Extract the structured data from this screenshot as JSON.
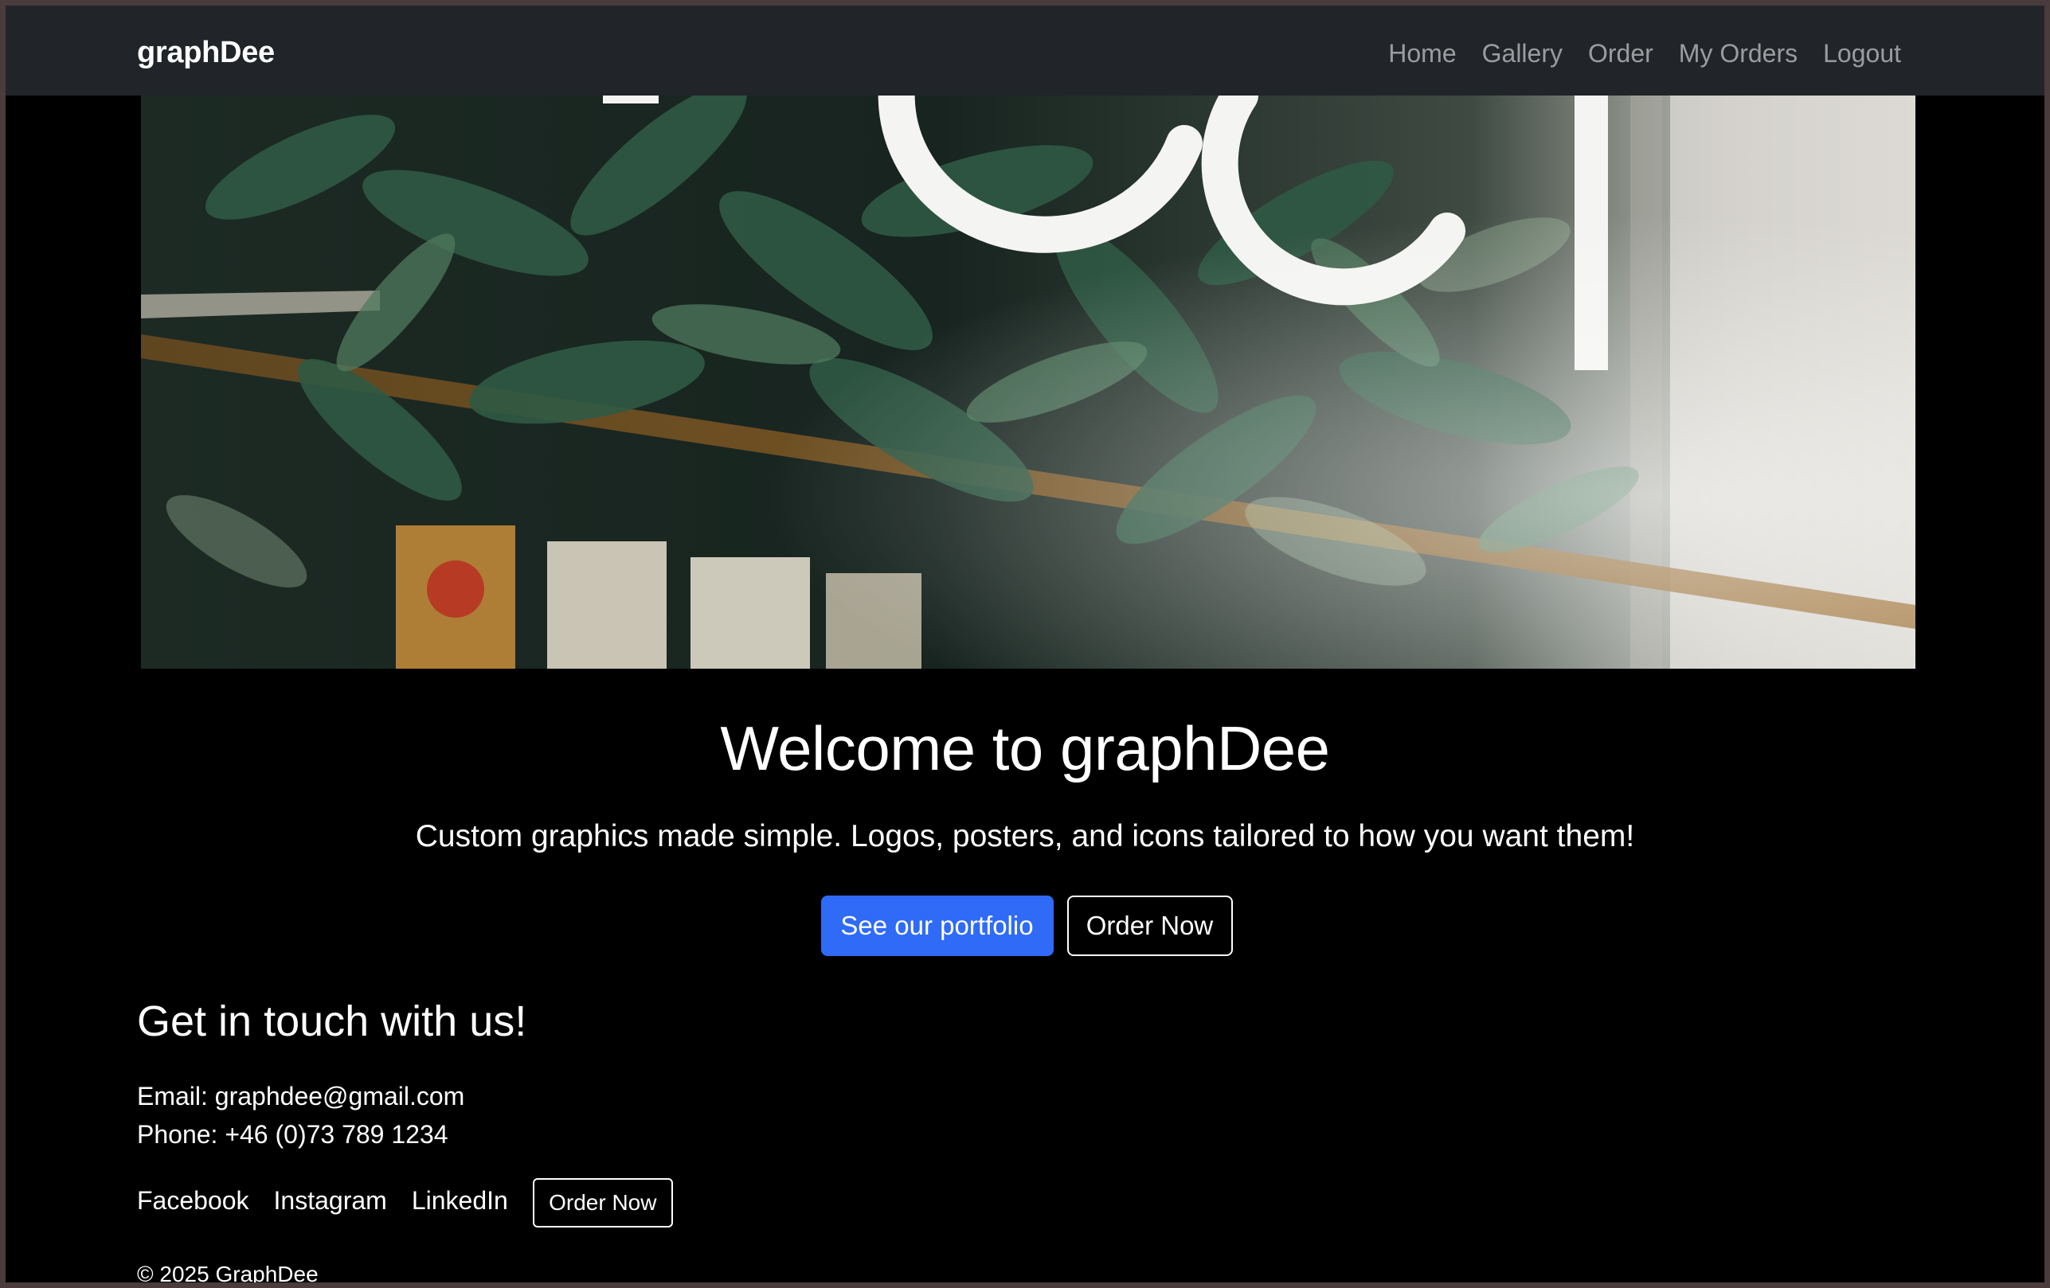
{
  "navbar": {
    "brand": "graphDee",
    "links": [
      {
        "label": "Home"
      },
      {
        "label": "Gallery"
      },
      {
        "label": "Order"
      },
      {
        "label": "My Orders"
      },
      {
        "label": "Logout"
      }
    ]
  },
  "hero": {
    "image_icon": "hero-photo",
    "title": "Welcome to graphDee",
    "tagline": "Custom graphics made simple. Logos, posters, and icons tailored to how you want them!",
    "primary_button": "See our portfolio",
    "secondary_button": "Order Now"
  },
  "contact": {
    "heading": "Get in touch with us!",
    "email": "Email: graphdee@gmail.com",
    "phone": "Phone: +46 (0)73 789 1234",
    "social": [
      {
        "label": "Facebook"
      },
      {
        "label": "Instagram"
      },
      {
        "label": "LinkedIn"
      }
    ],
    "order_button": "Order Now"
  },
  "footer": {
    "copyright": "© 2025 GraphDee"
  },
  "colors": {
    "navbar_bg": "#212529",
    "page_bg": "#000000",
    "primary": "#2f6bf6",
    "nav_link": "rgba(255,255,255,0.55)"
  }
}
